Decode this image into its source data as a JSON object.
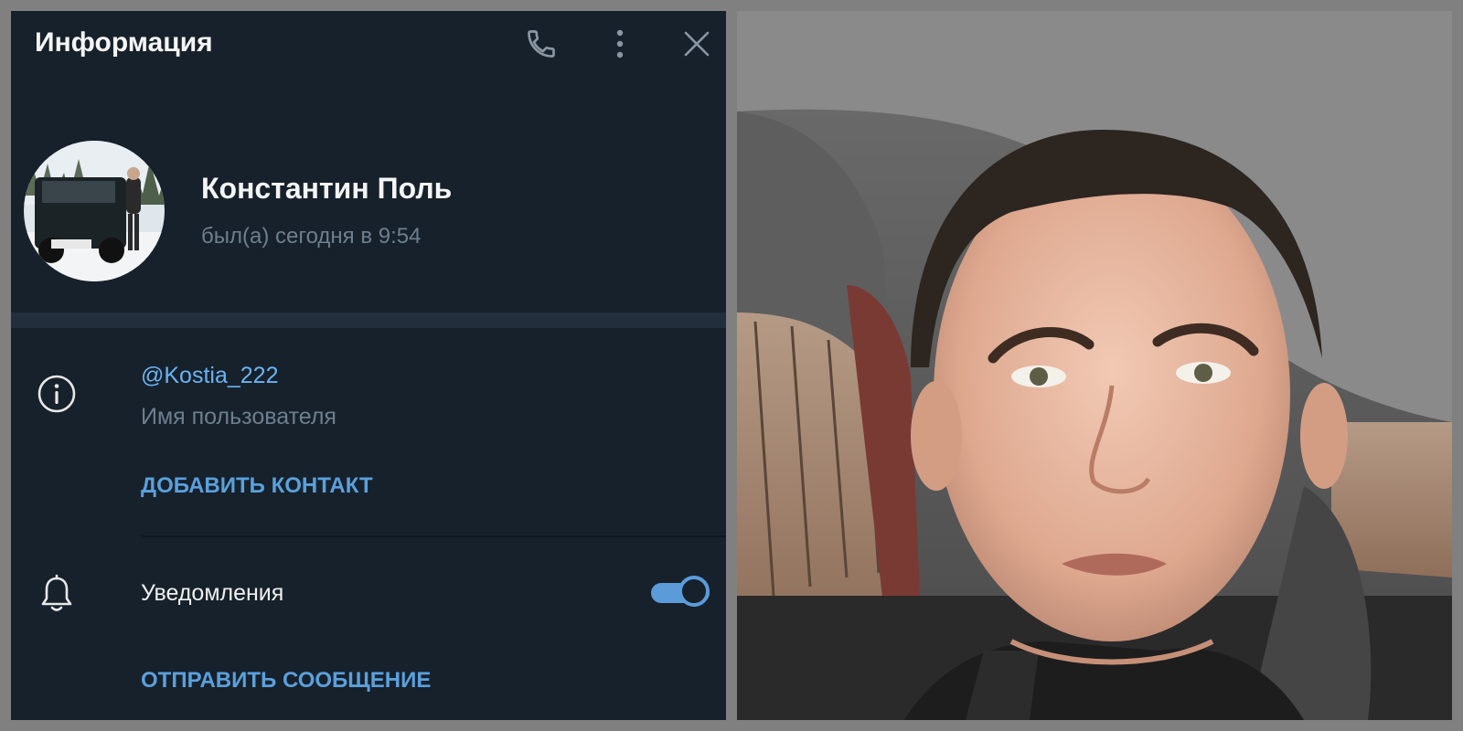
{
  "header": {
    "title": "Информация",
    "call_icon": "phone-icon",
    "more_icon": "vertical-dots-icon",
    "close_icon": "close-icon"
  },
  "profile": {
    "name": "Константин Поль",
    "status": "был(а) сегодня в 9:54"
  },
  "info": {
    "icon": "info-icon",
    "username": "@Kostia_222",
    "username_label": "Имя пользователя",
    "add_contact": "ДОБАВИТЬ КОНТАКТ"
  },
  "notifications": {
    "icon": "bell-icon",
    "label": "Уведомления",
    "enabled": true
  },
  "send_message": "ОТПРАВИТЬ СООБЩЕНИЕ",
  "colors": {
    "panel_bg": "#17212b",
    "accent": "#6ab3f3",
    "muted": "#6d7f8f",
    "toggle": "#5b9bd9"
  }
}
